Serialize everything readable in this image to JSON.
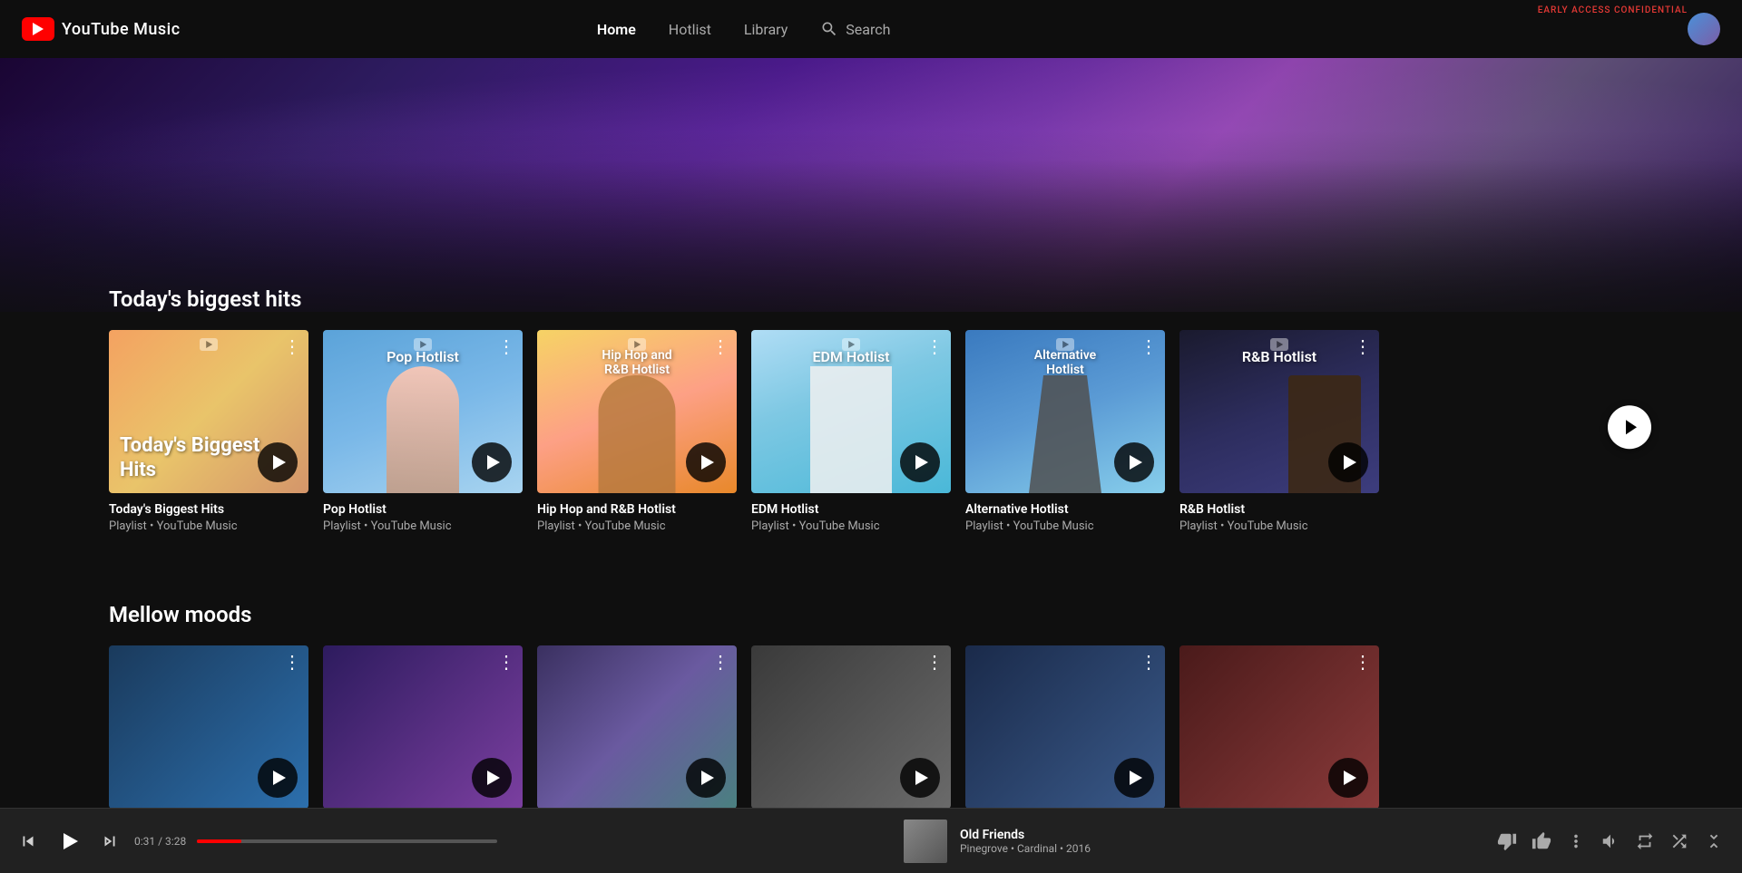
{
  "app": {
    "title": "YouTube Music",
    "early_access": "EARLY ACCESS CONFIDENTIAL"
  },
  "nav": {
    "home": "Home",
    "hotlist": "Hotlist",
    "library": "Library",
    "search": "Search"
  },
  "hero": {
    "section_title": "Today's biggest hits"
  },
  "cards_row_1": [
    {
      "title": "Today's Biggest Hits",
      "subtitle": "Playlist • YouTube Music",
      "label": "Today's Biggest Hits",
      "bg": "card-1-bg"
    },
    {
      "title": "Pop Hotlist",
      "subtitle": "Playlist • YouTube Music",
      "label": "Pop Hotlist",
      "bg": "card-2-bg"
    },
    {
      "title": "Hip Hop and R&B Hotlist",
      "subtitle": "Playlist • YouTube Music",
      "label": "Hip Hop and R&B Hotlist",
      "bg": "card-3-bg"
    },
    {
      "title": "EDM Hotlist",
      "subtitle": "Playlist • YouTube Music",
      "label": "EDM Hotlist",
      "bg": "card-4-bg"
    },
    {
      "title": "Alternative Hotlist",
      "subtitle": "Playlist • YouTube Music",
      "label": "Alternative Hotlist",
      "bg": "card-5-bg"
    },
    {
      "title": "R&B Hotlist",
      "subtitle": "Playlist • YouTube Music",
      "label": "R&B Hotlist",
      "bg": "card-6-bg"
    }
  ],
  "section2_title": "Mellow moods",
  "player": {
    "current_time": "0:31",
    "total_time": "3:28",
    "time_display": "0:31 / 3:28",
    "progress_pct": 14.9,
    "track_name": "Old Friends",
    "track_artist": "Pinegrove",
    "track_album": "Cardinal",
    "track_year": "2016",
    "track_meta": "Pinegrove • Cardinal • 2016"
  }
}
